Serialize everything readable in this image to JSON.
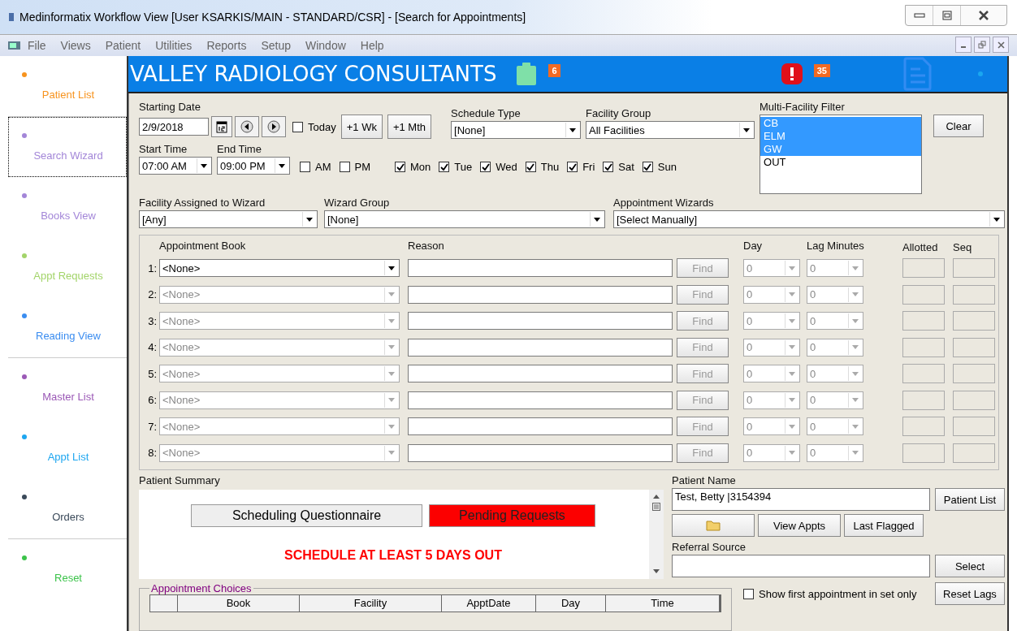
{
  "window": {
    "title": "Medinformatix Workflow View [User KSARKIS/MAIN - STANDARD/CSR] - [Search for Appointments]"
  },
  "menu": [
    "File",
    "Views",
    "Patient",
    "Utilities",
    "Reports",
    "Setup",
    "Window",
    "Help"
  ],
  "sidebar": {
    "groups": [
      [
        {
          "label": "Patient List",
          "color": "#f7931e",
          "selected": false
        }
      ],
      [
        {
          "label": "Search Wizard",
          "color": "#a386d8",
          "selected": true
        },
        {
          "label": "Books View",
          "color": "#a386d8",
          "selected": false
        },
        {
          "label": "Appt Requests",
          "color": "#a3d46a",
          "selected": false
        },
        {
          "label": "Reading View",
          "color": "#3b8df0",
          "selected": false
        }
      ],
      [
        {
          "label": "Master List",
          "color": "#9b59b6",
          "selected": false
        },
        {
          "label": "Appt List",
          "color": "#1ea6f0",
          "selected": false
        },
        {
          "label": "Orders",
          "color": "#3b4a5a",
          "selected": false
        }
      ],
      [
        {
          "label": "Reset",
          "color": "#3cc34a",
          "selected": false
        }
      ]
    ]
  },
  "banner": {
    "title": "VALLEY RADIOLOGY CONSULTANTS",
    "tasks_count": "6",
    "alerts_count": "35"
  },
  "form": {
    "starting_date": {
      "label": "Starting Date",
      "value": "2/9/2018"
    },
    "today": {
      "label": "Today",
      "checked": false
    },
    "buttons": [
      "+1 Wk",
      "+1 Mth"
    ],
    "schedule_type": {
      "label": "Schedule Type",
      "value": "[None]"
    },
    "facility_group": {
      "label": "Facility Group",
      "value": "All Facilities"
    },
    "multi_facility_filter": {
      "label": "Multi-Facility Filter",
      "items": [
        {
          "label": "CB",
          "selected": true
        },
        {
          "label": "ELM",
          "selected": true
        },
        {
          "label": "GW",
          "selected": true
        },
        {
          "label": "OUT",
          "selected": false
        }
      ],
      "clear": "Clear"
    },
    "start_time": {
      "label": "Start Time",
      "value": "07:00 AM"
    },
    "end_time": {
      "label": "End Time",
      "value": "09:00 PM"
    },
    "periods": [
      {
        "label": "AM",
        "checked": false
      },
      {
        "label": "PM",
        "checked": false
      }
    ],
    "days": [
      {
        "label": "Mon",
        "checked": true
      },
      {
        "label": "Tue",
        "checked": true
      },
      {
        "label": "Wed",
        "checked": true
      },
      {
        "label": "Thu",
        "checked": true
      },
      {
        "label": "Fri",
        "checked": true
      },
      {
        "label": "Sat",
        "checked": true
      },
      {
        "label": "Sun",
        "checked": true
      }
    ],
    "facility_assigned": {
      "label": "Facility Assigned to Wizard",
      "value": "[Any]"
    },
    "wizard_group": {
      "label": "Wizard Group",
      "value": "[None]"
    },
    "appointment_wizards": {
      "label": "Appointment Wizards",
      "value": "[Select Manually]"
    }
  },
  "appointments": {
    "columns": [
      "Appointment Book",
      "Reason",
      "Day",
      "Lag Minutes",
      "Allotted",
      "Seq"
    ],
    "rows": [
      {
        "number": "1:",
        "book": "<None>",
        "disabled": false,
        "find": "Find",
        "day": "0",
        "lag": "0"
      },
      {
        "number": "2:",
        "book": "<None>",
        "disabled": true,
        "find": "Find",
        "day": "0",
        "lag": "0"
      },
      {
        "number": "3:",
        "book": "<None>",
        "disabled": true,
        "find": "Find",
        "day": "0",
        "lag": "0"
      },
      {
        "number": "4:",
        "book": "<None>",
        "disabled": true,
        "find": "Find",
        "day": "0",
        "lag": "0"
      },
      {
        "number": "5:",
        "book": "<None>",
        "disabled": true,
        "find": "Find",
        "day": "0",
        "lag": "0"
      },
      {
        "number": "6:",
        "book": "<None>",
        "disabled": true,
        "find": "Find",
        "day": "0",
        "lag": "0"
      },
      {
        "number": "7:",
        "book": "<None>",
        "disabled": true,
        "find": "Find",
        "day": "0",
        "lag": "0"
      },
      {
        "number": "8:",
        "book": "<None>",
        "disabled": true,
        "find": "Find",
        "day": "0",
        "lag": "0"
      }
    ]
  },
  "patient_summary": {
    "label": "Patient Summary",
    "buttons": [
      {
        "label": "Scheduling Questionnaire",
        "kind": "plain"
      },
      {
        "label": "Pending Requests",
        "kind": "alert"
      }
    ],
    "notice": "SCHEDULE AT LEAST 5 DAYS OUT"
  },
  "patient": {
    "label": "Patient Name",
    "value": "Test, Betty  |3154394",
    "patient_list": "Patient List",
    "view_appts": "View Appts",
    "last_flagged": "Last Flagged",
    "referral_label": "Referral Source",
    "select": "Select",
    "show_first": {
      "label": "Show first appointment in set only",
      "checked": false
    },
    "reset_lags": "Reset Lags"
  },
  "appointment_choices": {
    "label": "Appointment Choices",
    "columns": [
      "Book",
      "Facility",
      "ApptDate",
      "Day",
      "Time"
    ]
  }
}
